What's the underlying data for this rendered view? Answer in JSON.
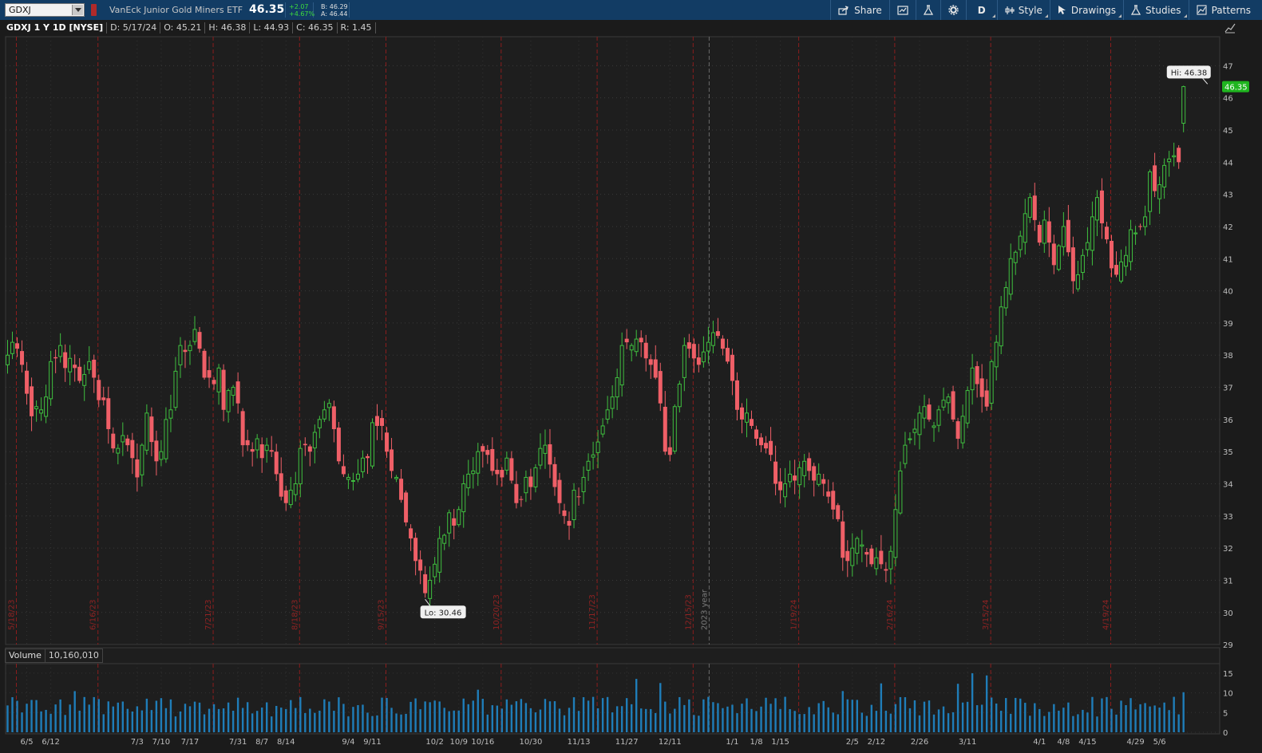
{
  "toolbar": {
    "symbol": "GDXJ",
    "description": "VanEck Junior Gold Miners ETF",
    "last": "46.35",
    "change": "+2.07",
    "change_pct": "+4.67%",
    "bid": "B: 46.29",
    "ask": "A: 46.44",
    "buttons": {
      "share": "Share",
      "aggregation": "D",
      "style": "Style",
      "drawings": "Drawings",
      "studies": "Studies",
      "patterns": "Patterns"
    }
  },
  "header": {
    "symbol_period": "GDXJ 1 Y 1D [NYSE]",
    "date": "D: 5/17/24",
    "open": "O: 45.21",
    "high": "H: 46.38",
    "low": "L: 44.93",
    "close": "C: 46.35",
    "range": "R: 1.45"
  },
  "volume_panel": {
    "label": "Volume",
    "value": "10,160,010"
  },
  "colors": {
    "up": "#3fbf3f",
    "down": "#ef5f67",
    "volume": "#1f7db8",
    "price_tag": "#1fb51f",
    "event_line": "#8b1d1d",
    "background": "#1b1b1b"
  },
  "chart_data": {
    "type": "candlestick",
    "price_axis": {
      "ylim": [
        29,
        47.5
      ],
      "ticks": [
        30,
        31,
        32,
        33,
        34,
        35,
        36,
        37,
        38,
        39,
        40,
        41,
        42,
        43,
        44,
        45,
        46,
        47
      ]
    },
    "volume_axis": {
      "unit": "M",
      "ylim": [
        0,
        17
      ],
      "ticks": [
        0,
        5,
        10,
        15
      ]
    },
    "x_labels": [
      "6/5",
      "6/12",
      "7/3",
      "7/10",
      "7/17",
      "7/31",
      "8/7",
      "8/14",
      "9/4",
      "9/11",
      "10/2",
      "10/9",
      "10/16",
      "10/30",
      "11/13",
      "11/27",
      "12/11",
      "1/1",
      "1/8",
      "1/15",
      "2/5",
      "2/12",
      "2/26",
      "3/11",
      "4/1",
      "4/8",
      "4/15",
      "4/29",
      "5/6"
    ],
    "x_label_bar_index": [
      4,
      9,
      27,
      32,
      38,
      48,
      53,
      58,
      71,
      76,
      89,
      94,
      99,
      109,
      119,
      129,
      138,
      151,
      156,
      161,
      176,
      181,
      190,
      200,
      215,
      220,
      225,
      235,
      240
    ],
    "event_markers": [
      {
        "label": "5/18/23",
        "bar": 0
      },
      {
        "label": "6/16/23",
        "bar": 17
      },
      {
        "label": "7/21/23",
        "bar": 41
      },
      {
        "label": "8/18/23",
        "bar": 59
      },
      {
        "label": "9/15/23",
        "bar": 77
      },
      {
        "label": "10/20/23",
        "bar": 101
      },
      {
        "label": "11/17/23",
        "bar": 121
      },
      {
        "label": "12/15/23",
        "bar": 141
      },
      {
        "label": "1/19/24",
        "bar": 163
      },
      {
        "label": "2/16/24",
        "bar": 183
      },
      {
        "label": "3/15/24",
        "bar": 203
      },
      {
        "label": "4/19/24",
        "bar": 228
      }
    ],
    "year_marker": {
      "label": "2023 year",
      "bar": 146
    },
    "hi_label": "Hi: 46.38",
    "lo_label": "Lo: 30.46",
    "hi": {
      "value": 46.38,
      "bar": 250
    },
    "lo": {
      "value": 30.46,
      "bar": 87
    },
    "last_price": 46.35,
    "closes": [
      38.0,
      38.4,
      38.2,
      37.7,
      36.8,
      36.1,
      36.4,
      36.3,
      36.7,
      37.8,
      37.9,
      38.3,
      37.6,
      37.9,
      37.6,
      37.2,
      37.4,
      37.8,
      37.3,
      36.6,
      36.6,
      35.7,
      35.1,
      35.1,
      35.5,
      35.2,
      34.8,
      34.2,
      35.2,
      36.2,
      35.3,
      34.7,
      35.0,
      36.0,
      36.3,
      37.5,
      38.3,
      38.1,
      38.3,
      38.8,
      38.2,
      37.3,
      37.3,
      37.1,
      37.6,
      36.3,
      36.9,
      37.0,
      36.5,
      35.2,
      35.2,
      35.0,
      35.4,
      34.8,
      35.2,
      35.0,
      34.3,
      33.6,
      33.4,
      33.8,
      34.0,
      35.1,
      35.2,
      35.0,
      35.6,
      36.0,
      36.3,
      36.5,
      35.7,
      34.7,
      34.3,
      34.2,
      34.1,
      34.3,
      34.8,
      34.8,
      35.9,
      35.8,
      35.8,
      35.0,
      34.4,
      34.2,
      33.5,
      32.8,
      32.3,
      31.6,
      31.3,
      30.6,
      31.0,
      31.5,
      32.3,
      32.4,
      33.1,
      32.7,
      33.2,
      34.0,
      34.3,
      34.4,
      35.0,
      35.0,
      34.9,
      34.4,
      34.3,
      34.2,
      34.8,
      34.1,
      33.4,
      33.5,
      34.2,
      33.9,
      34.5,
      35.1,
      35.2,
      34.6,
      33.9,
      33.4,
      33.0,
      32.7,
      33.8,
      33.6,
      34.2,
      34.7,
      34.9,
      35.3,
      35.8,
      36.3,
      36.7,
      37.3,
      38.3,
      38.4,
      38.3,
      38.5,
      38.4,
      37.9,
      37.7,
      37.3,
      36.5,
      35.0,
      34.9,
      36.4,
      37.1,
      38.3,
      38.2,
      37.9,
      37.7,
      38.1,
      38.4,
      38.7,
      38.6,
      38.2,
      37.8,
      37.2,
      36.3,
      36.0,
      36.2,
      35.8,
      35.4,
      35.2,
      35.1,
      34.9,
      34.0,
      33.8,
      34.0,
      34.3,
      34.1,
      34.5,
      34.7,
      34.4,
      34.1,
      34.3,
      34.0,
      33.6,
      33.2,
      32.9,
      31.7,
      31.6,
      32.0,
      32.3,
      32.1,
      31.8,
      31.5,
      31.7,
      31.5,
      31.3,
      31.9,
      33.2,
      34.4,
      35.2,
      35.4,
      35.7,
      36.2,
      36.4,
      36.0,
      35.8,
      36.3,
      36.6,
      36.7,
      36.0,
      35.4,
      36.1,
      36.9,
      37.6,
      37.1,
      36.7,
      36.4,
      37.8,
      38.4,
      39.5,
      40.1,
      41.0,
      41.2,
      41.7,
      42.4,
      42.9,
      42.2,
      41.5,
      42.2,
      41.5,
      40.8,
      41.4,
      42.0,
      41.2,
      40.3,
      40.5,
      41.1,
      41.5,
      42.3,
      42.9,
      42.1,
      41.6,
      40.7,
      40.5,
      40.9,
      41.1,
      41.9,
      41.8,
      42.0,
      42.3,
      43.7,
      43.1,
      43.3,
      43.9,
      44.1,
      44.2,
      44.0,
      46.35
    ]
  }
}
